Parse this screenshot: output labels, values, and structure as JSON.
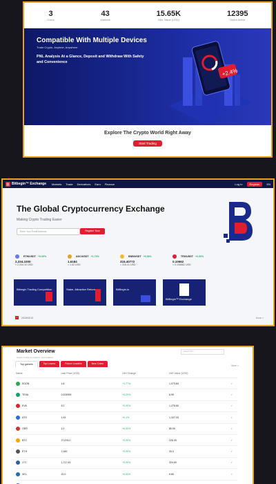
{
  "panel1": {
    "stats": [
      {
        "value": "3",
        "label": "Coins"
      },
      {
        "value": "43",
        "label": "Markets"
      },
      {
        "value": "15.65K",
        "label": "24hr Value (USD)"
      },
      {
        "value": "12395",
        "label": "Users Active"
      }
    ],
    "hero": {
      "title": "Compatible With Multiple Devices",
      "subtitle": "Trade Crypto, Anytime, Anywhere",
      "desc": "PNL Analysis At a Glance, Deposit and Withdraw With Safety and Convenience",
      "phone_badge": "+2.4%"
    },
    "explore": {
      "text": "Explore The Crypto World Right Away",
      "button": "Start Trading"
    }
  },
  "panel2": {
    "nav": {
      "brand": "Bitbegin™ Exchange",
      "items": [
        "Markets",
        "Trade",
        "Derivatives",
        "Earn",
        "Finance"
      ],
      "login": "Log In",
      "register": "Register",
      "lang": "EN"
    },
    "title": "The Global Cryptocurrency Exchange",
    "subtitle": "Making Crypto Trading Easier",
    "email_placeholder": "Enter Your Email Address",
    "register_button": "Register Now",
    "tickers": [
      {
        "pair": "ETH/USDT",
        "change": "+0.00%",
        "price": "2,334.1000",
        "usd": "≈ 2,334.10 USD"
      },
      {
        "pair": "ADC/USDT",
        "change": "+1.73%",
        "price": "1.6184",
        "usd": "≈ 1.62 USD"
      },
      {
        "pair": "BNB/USDT",
        "change": "+6.36%",
        "price": "315.40772",
        "usd": "≈ 315.41 USD"
      },
      {
        "pair": "TRX/USDT",
        "change": "+0.00%",
        "price": "0.10662",
        "usd": "≈ 0.106662 USD"
      }
    ],
    "cards": [
      "Bitbegin Trading Competition",
      "Stake, Attractive Return",
      "BitBegin.io",
      "BitBegin™ Exchange"
    ],
    "pager_date": "2023/02/13",
    "more": "More >"
  },
  "panel3": {
    "title": "Market Overview",
    "subtitle": "Crypto market at a glance, last updated",
    "search_placeholder": "Search Coin",
    "tabs": [
      "Top gainers",
      "Top Losers",
      "Future Leaders",
      "New Coins"
    ],
    "more": "More >",
    "columns": [
      "Name",
      "Last Price (USD)",
      "24H Change",
      "24H Value (USD)",
      ""
    ],
    "rows": [
      {
        "name": "KDON",
        "price": "1.8",
        "change": "+1.77%",
        "value": "1,073.84",
        "color": "#2ea44f"
      },
      {
        "name": "TEVA",
        "price": "0.024959",
        "change": "+4.29%",
        "value": "6.99",
        "color": "#1c9c74"
      },
      {
        "name": "EVA",
        "price": "5.2",
        "change": "+0.00%",
        "value": "1,276.60",
        "color": "#d42a2a"
      },
      {
        "name": "ATO",
        "price": "1.93",
        "change": "+0.1%",
        "value": "1,337.33",
        "color": "#2d6be0"
      },
      {
        "name": "OER",
        "price": "1.0",
        "change": "+0.00%",
        "value": "80.00",
        "color": "#c4372d"
      },
      {
        "name": "BTC",
        "price": "27,676.0",
        "change": "+0.00%",
        "value": "226.05",
        "color": "#f2a900"
      },
      {
        "name": "ETH",
        "price": "2,160",
        "change": "+0.00%",
        "value": "33.3",
        "color": "#555"
      },
      {
        "name": "LTC",
        "price": "1,717.63",
        "change": "+0.00%",
        "value": "324.60",
        "color": "#345d9d"
      },
      {
        "name": "XEL",
        "price": "22.0",
        "change": "+0.00%",
        "value": "6.80",
        "color": "#2a6ab6"
      },
      {
        "name": "SC",
        "price": "82.0",
        "change": "+0.00%",
        "value": "1.40",
        "color": "#1f5bd6"
      }
    ]
  }
}
